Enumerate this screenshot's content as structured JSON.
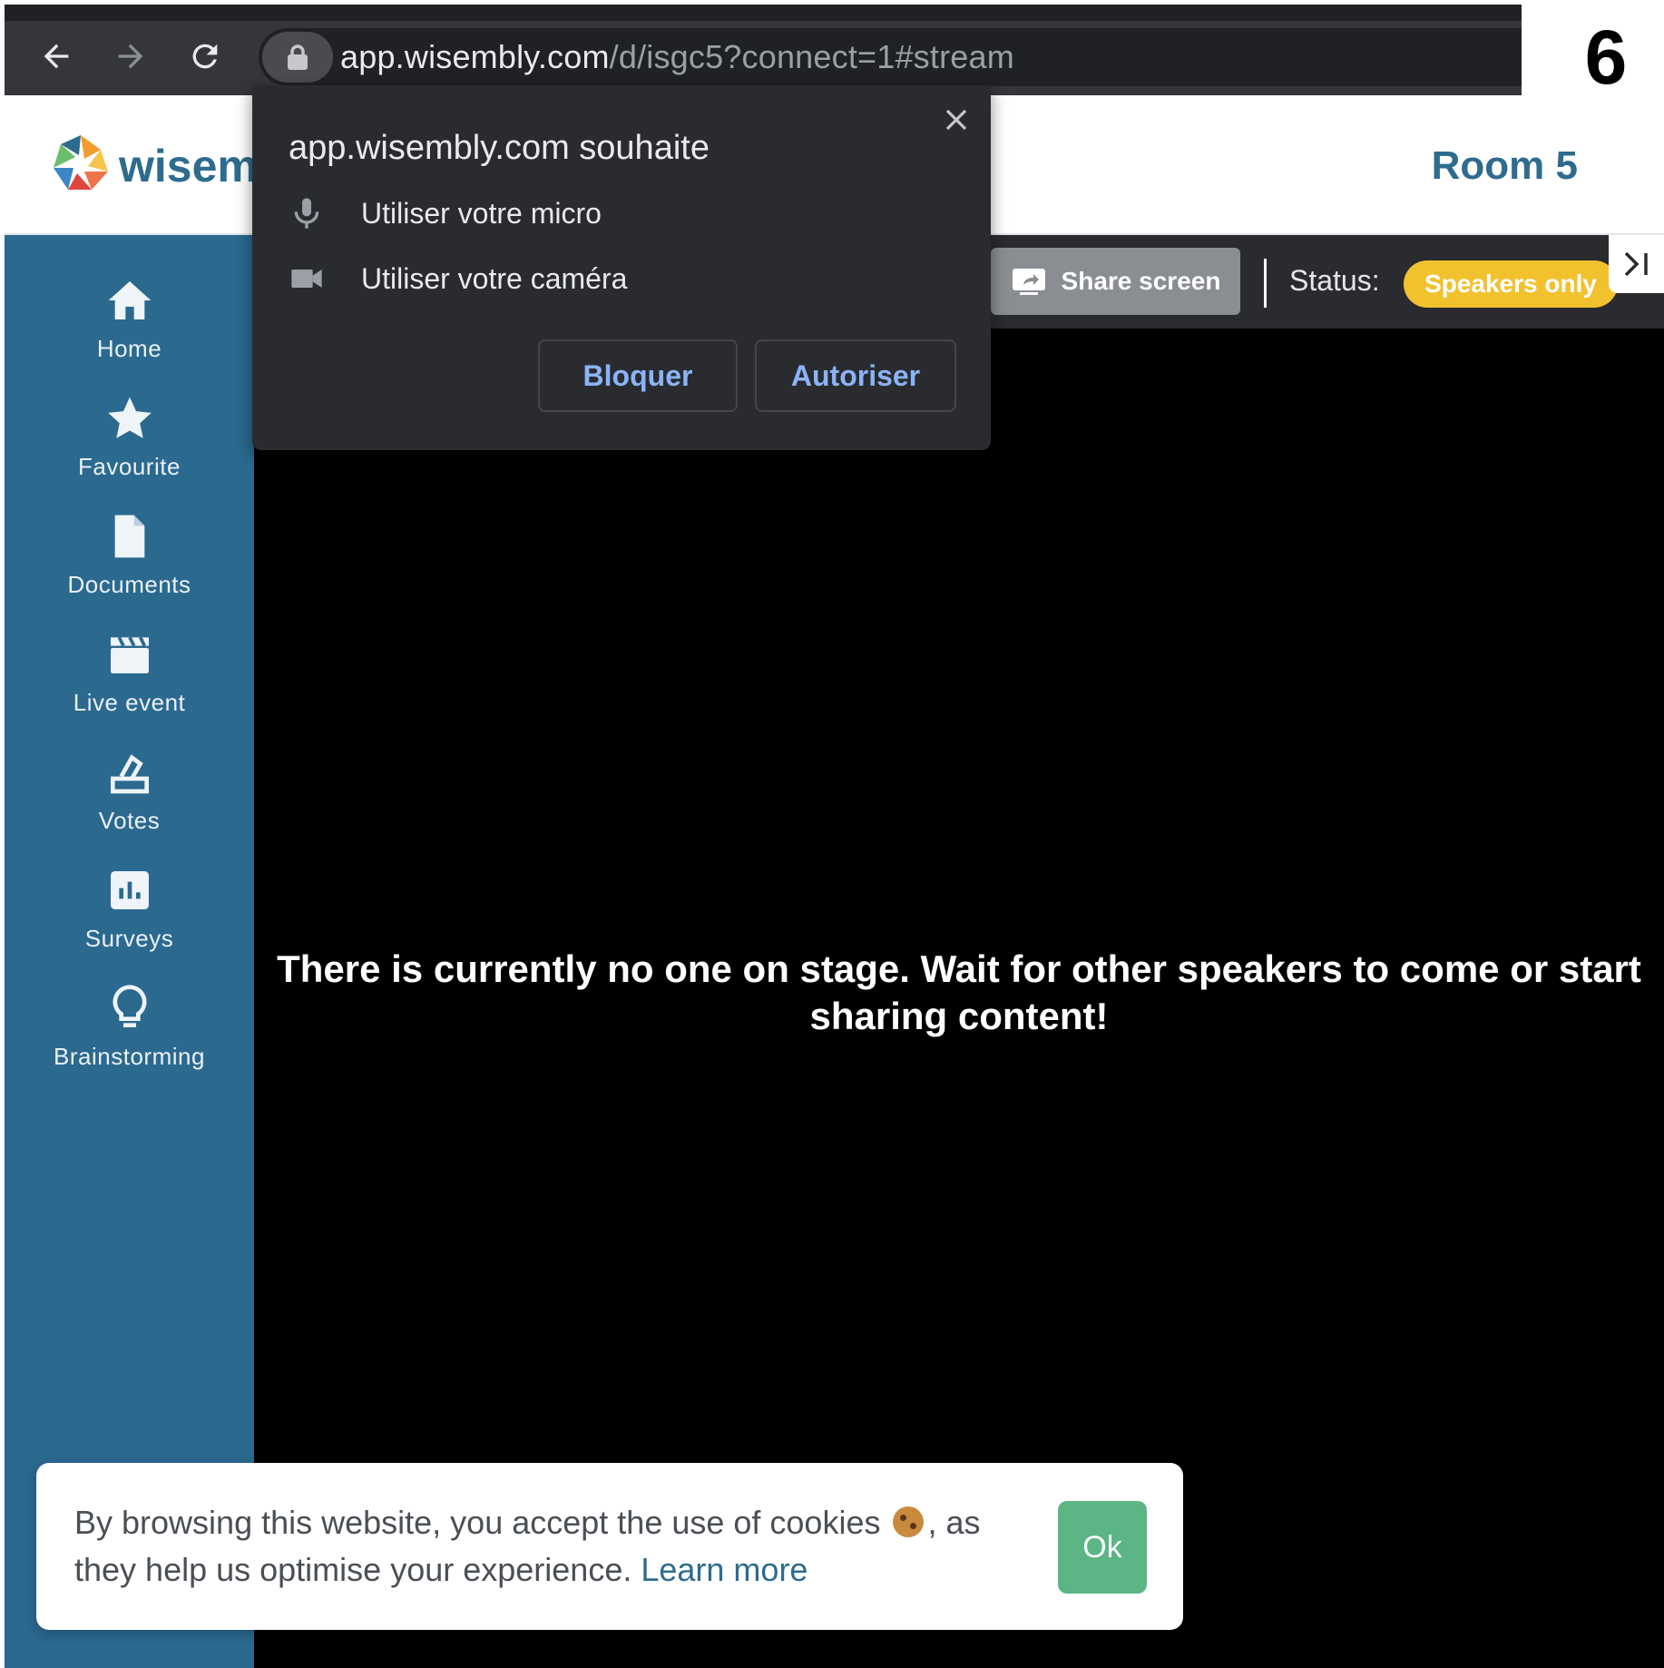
{
  "step_number": "6",
  "browser": {
    "url_host": "app.wisembly.com",
    "url_path": "/d/isgc5?connect=1#stream",
    "icons": [
      "back-arrow-icon",
      "forward-arrow-icon",
      "reload-icon",
      "lock-icon"
    ]
  },
  "header": {
    "brand": "wisem",
    "room_title": "Room 5"
  },
  "sidebar": {
    "items": [
      {
        "label": "Home",
        "icon": "home-icon"
      },
      {
        "label": "Favourite",
        "icon": "star-icon"
      },
      {
        "label": "Documents",
        "icon": "document-icon"
      },
      {
        "label": "Live event",
        "icon": "clapperboard-icon"
      },
      {
        "label": "Votes",
        "icon": "ballot-icon"
      },
      {
        "label": "Surveys",
        "icon": "bar-chart-icon"
      },
      {
        "label": "Brainstorming",
        "icon": "lightbulb-icon"
      }
    ]
  },
  "toolbar": {
    "share_label": "Share screen",
    "status_label": "Status:",
    "status_value": "Speakers only"
  },
  "stage": {
    "message": "There is currently no one on stage. Wait for other speakers to come or start sharing content!"
  },
  "permission_popup": {
    "title": "app.wisembly.com souhaite",
    "mic_label": "Utiliser votre micro",
    "camera_label": "Utiliser votre caméra",
    "block_label": "Bloquer",
    "allow_label": "Autoriser"
  },
  "cookie_banner": {
    "text_before": "By browsing this website, you accept the use of cookies",
    "text_after": ", as they help us optimise your experience.",
    "link_text": "Learn more",
    "ok_label": "Ok"
  },
  "colors": {
    "brand_blue": "#2e6c8e",
    "sidebar_bg": "#2b698f",
    "status_yellow": "#f2c12e",
    "ok_green": "#5bb585",
    "link_blue": "#8ab4f8"
  }
}
